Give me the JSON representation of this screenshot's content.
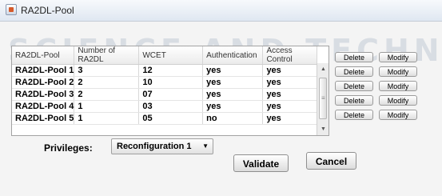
{
  "window": {
    "title": "RA2DL-Pool",
    "watermark": "SCIENCE AND TECHNOLOGY"
  },
  "table": {
    "columns": [
      "RA2DL-Pool",
      "Number of RA2DL",
      "WCET",
      "Authentication",
      "Access Control"
    ],
    "rows": [
      [
        "RA2DL-Pool 1",
        "3",
        "12",
        "yes",
        "yes"
      ],
      [
        "RA2DL-Pool 2",
        "2",
        "10",
        "yes",
        "yes"
      ],
      [
        "RA2DL-Pool 3",
        "2",
        "07",
        "yes",
        "yes"
      ],
      [
        "RA2DL-Pool 4",
        "1",
        "03",
        "yes",
        "yes"
      ],
      [
        "RA2DL-Pool 5",
        "1",
        "05",
        "no",
        "yes"
      ]
    ]
  },
  "row_actions": {
    "delete_label": "Delete",
    "modify_label": "Modify"
  },
  "privileges": {
    "label": "Privileges:",
    "selected": "Reconfiguration 1"
  },
  "buttons": {
    "validate": "Validate",
    "cancel": "Cancel"
  }
}
